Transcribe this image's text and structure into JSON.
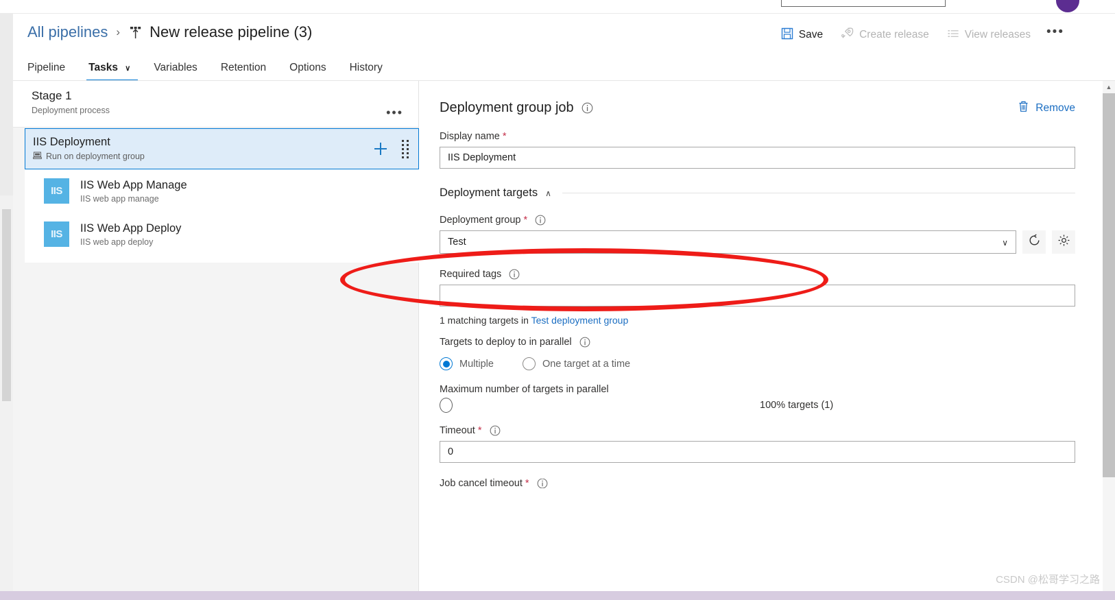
{
  "topbar": {
    "avatar": "user-avatar"
  },
  "breadcrumb": {
    "root": "All pipelines",
    "separator": "›",
    "title": "New release pipeline (3)"
  },
  "commandbar": {
    "items": [
      {
        "icon": "save-icon",
        "label": "Save",
        "disabled": false
      },
      {
        "icon": "rocket-icon",
        "label": "Create release",
        "disabled": true
      },
      {
        "icon": "list-icon",
        "label": "View releases",
        "disabled": true
      }
    ],
    "overflow": "•••"
  },
  "tabs": [
    {
      "label": "Pipeline",
      "active": false,
      "chevron": ""
    },
    {
      "label": "Tasks",
      "active": true,
      "chevron": "∨"
    },
    {
      "label": "Variables",
      "active": false,
      "chevron": ""
    },
    {
      "label": "Retention",
      "active": false,
      "chevron": ""
    },
    {
      "label": "Options",
      "active": false,
      "chevron": ""
    },
    {
      "label": "History",
      "active": false,
      "chevron": ""
    }
  ],
  "left_panel": {
    "stage": {
      "name": "Stage 1",
      "subtitle": "Deployment process",
      "menu": "•••"
    },
    "job": {
      "title": "IIS Deployment",
      "subtitle": "Run on deployment group",
      "add": "+",
      "selected": true
    },
    "tasks": [
      {
        "icon_text": "IIS",
        "title": "IIS Web App Manage",
        "subtitle": "IIS web app manage"
      },
      {
        "icon_text": "IIS",
        "title": "IIS Web App Deploy",
        "subtitle": "IIS web app deploy"
      }
    ]
  },
  "right_panel": {
    "title": "Deployment group job",
    "remove_label": "Remove",
    "display_name": {
      "label": "Display name",
      "required": "*",
      "value": "IIS Deployment"
    },
    "section": {
      "label": "Deployment targets",
      "chevron": "∧"
    },
    "deployment_group": {
      "label": "Deployment group",
      "required": "*",
      "value": "Test",
      "chevron": "∨",
      "refresh_icon": "refresh-icon",
      "settings_icon": "gear-icon"
    },
    "required_tags": {
      "label": "Required tags",
      "value": "",
      "placeholder": ""
    },
    "matching": {
      "prefix": "1 matching targets in ",
      "link": "Test deployment group"
    },
    "parallel": {
      "label": "Targets to deploy to in parallel",
      "options": [
        {
          "label": "Multiple",
          "checked": true
        },
        {
          "label": "One target at a time",
          "checked": false
        }
      ]
    },
    "max_parallel": {
      "label": "Maximum number of targets in parallel",
      "value_text": "100% targets (1)",
      "slider_position": 0
    },
    "timeout": {
      "label": "Timeout",
      "required": "*",
      "value": "0"
    },
    "job_cancel_timeout": {
      "label": "Job cancel timeout",
      "required": "*"
    }
  },
  "watermark": "CSDN @松哥学习之路",
  "colors": {
    "accent": "#0078d4",
    "link": "#1b6ec2",
    "annotation": "#ee1c18",
    "selected_bg": "#deecf9",
    "task_icon": "#55b3e4",
    "required": "#c4314b"
  }
}
